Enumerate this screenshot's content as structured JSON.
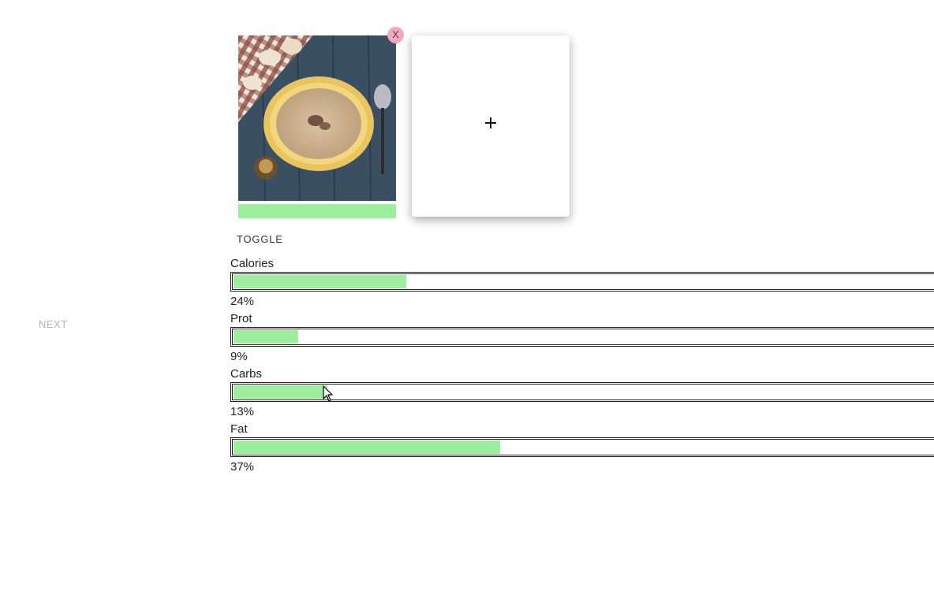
{
  "nav": {
    "next_label": "NEXT"
  },
  "food_image": {
    "close_label": "X",
    "icon": "soup-photo"
  },
  "add_card": {
    "icon": "plus-icon"
  },
  "toggle_label": "TOGGLE",
  "nutrients": [
    {
      "label": "Calories",
      "percent_text": "24%",
      "percent": 24
    },
    {
      "label": "Prot",
      "percent_text": "9%",
      "percent": 9
    },
    {
      "label": "Carbs",
      "percent_text": "13%",
      "percent": 13
    },
    {
      "label": "Fat",
      "percent_text": "37%",
      "percent": 37
    }
  ],
  "colors": {
    "bar_fill": "#9dee9d",
    "close_badge": "#f2a6c0"
  }
}
